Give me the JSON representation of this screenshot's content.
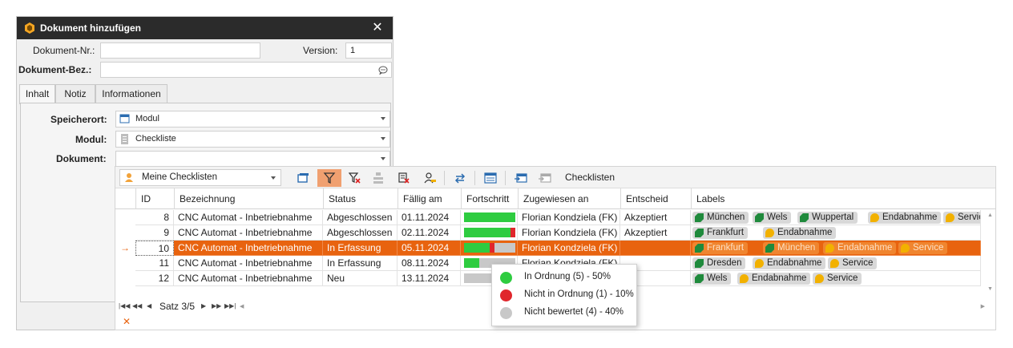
{
  "dialog": {
    "title": "Dokument hinzufügen",
    "close_glyph": "✕",
    "doc_nr_label": "Dokument-Nr.:",
    "doc_nr_value": "",
    "version_label": "Version:",
    "version_value": "1",
    "doc_bez_label": "Dokument-Bez.:",
    "doc_bez_value": "",
    "tabs": [
      "Inhalt",
      "Notiz",
      "Informationen"
    ],
    "active_tab": "Inhalt",
    "speicherort_label": "Speicherort:",
    "speicherort_value": "Modul",
    "modul_label": "Modul:",
    "modul_value": "Checkliste",
    "dokument_label": "Dokument:",
    "dokument_value": ""
  },
  "toolbar": {
    "view_value": "Meine Checklisten",
    "title": "Checklisten",
    "icons": [
      "window-icon",
      "filter-icon",
      "clear-filter-icon",
      "group-icon",
      "delete-icon",
      "user-edit-icon",
      "refresh-icon",
      "list-view-icon",
      "export-icon",
      "import-icon"
    ]
  },
  "grid": {
    "columns": [
      "ID",
      "Bezeichnung",
      "Status",
      "Fällig am",
      "Fortschritt",
      "Zugewiesen an",
      "Entscheid",
      "Labels"
    ],
    "rows": [
      {
        "id": "8",
        "bezeichnung": "CNC Automat - Inbetriebnahme",
        "status": "Abgeschlossen",
        "faellig": "01.11.2024",
        "progress": {
          "ok": 1.0,
          "nok": 0.0
        },
        "zugewiesen": "Florian Kondziela (FK)",
        "entscheid": "Akzeptiert",
        "labels": [
          {
            "text": "München",
            "type": "tag"
          },
          {
            "text": "Wels",
            "type": "tag"
          },
          {
            "text": "Wuppertal",
            "type": "tag"
          },
          {
            "text": "Endabnahme",
            "type": "pin"
          },
          {
            "text": "Service",
            "type": "pin"
          }
        ]
      },
      {
        "id": "9",
        "bezeichnung": "CNC Automat - Inbetriebnahme",
        "status": "Abgeschlossen",
        "faellig": "02.11.2024",
        "progress": {
          "ok": 0.9,
          "nok": 0.1
        },
        "zugewiesen": "Florian Kondziela (FK)",
        "entscheid": "Akzeptiert",
        "labels": [
          {
            "text": "Frankfurt",
            "type": "tag"
          },
          {
            "text": "Endabnahme",
            "type": "pin"
          }
        ]
      },
      {
        "id": "10",
        "bezeichnung": "CNC Automat - Inbetriebnahme",
        "status": "In Erfassung",
        "faellig": "05.11.2024",
        "progress": {
          "ok": 0.5,
          "nok": 0.1
        },
        "zugewiesen": "Florian Kondziela (FK)",
        "entscheid": "",
        "labels": [
          {
            "text": "Frankfurt",
            "type": "tag"
          },
          {
            "text": "München",
            "type": "tag"
          },
          {
            "text": "Endabnahme",
            "type": "pin"
          },
          {
            "text": "Service",
            "type": "pin"
          }
        ],
        "selected": true
      },
      {
        "id": "11",
        "bezeichnung": "CNC Automat - Inbetriebnahme",
        "status": "In Erfassung",
        "faellig": "08.11.2024",
        "progress": {
          "ok": 0.3,
          "nok": 0.0
        },
        "zugewiesen": "Florian Kondziela (FK)",
        "entscheid": "",
        "labels": [
          {
            "text": "Dresden",
            "type": "tag"
          },
          {
            "text": "Endabnahme",
            "type": "pin"
          },
          {
            "text": "Service",
            "type": "pin"
          }
        ]
      },
      {
        "id": "12",
        "bezeichnung": "CNC Automat - Inbetriebnahme",
        "status": "Neu",
        "faellig": "13.11.2024",
        "progress": {
          "ok": 0.0,
          "nok": 0.0
        },
        "zugewiesen": "",
        "entscheid": "",
        "labels": [
          {
            "text": "Wels",
            "type": "tag"
          },
          {
            "text": "Endabnahme",
            "type": "pin"
          },
          {
            "text": "Service",
            "type": "pin"
          }
        ]
      }
    ],
    "row_indicator": "→",
    "pager_text": "Satz 3/5",
    "footer_glyph": "✕"
  },
  "tooltip": {
    "items": [
      {
        "text": "In Ordnung (5) - 50%",
        "color": "#2ecc40"
      },
      {
        "text": "Nicht in Ordnung (1) - 10%",
        "color": "#e0262c"
      },
      {
        "text": "Nicht bewertet (4) - 40%",
        "color": "#c8c8c8"
      }
    ]
  },
  "colors": {
    "accent": "#e8630f",
    "ok": "#2ecc40",
    "nok": "#e0262c",
    "neutral": "#c8c8c8"
  }
}
